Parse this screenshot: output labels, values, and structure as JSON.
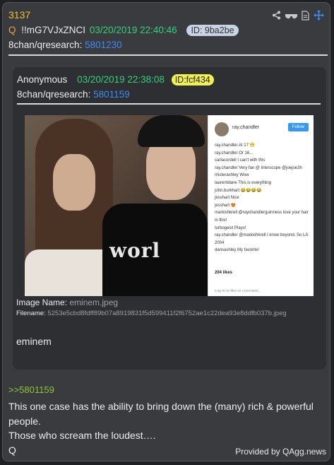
{
  "post": {
    "number": "3137",
    "q_marker": "Q",
    "tripcode": "!!mG7VJxZNCI",
    "datetime": "03/20/2019 22:40:46",
    "id_badge": "ID: 9ba2be",
    "board_label": "8chan/qresearch:",
    "board_link": "5801230",
    "reply_link": ">>5801159",
    "body_lines": [
      "This one case has the ability to bring down the (many) rich & powerful people.",
      "Those who scream the loudest….",
      "Q"
    ]
  },
  "actions": {
    "icons": [
      "share-icon",
      "glasses-icon",
      "document-icon",
      "move-icon"
    ],
    "accent": "#3d8cf5"
  },
  "quoted": {
    "author": "Anonymous",
    "datetime": "03/20/2019 22:38:08",
    "id_badge": "ID:fcf434",
    "board_label": "8chan/qresearch:",
    "board_link": "5801159",
    "image": {
      "shirt_text": "worl",
      "insta_username": "ray.chandler",
      "insta_follow": "Follow",
      "insta_comments": [
        "ray.chandler At 17 😁",
        "ray.chandler Or 16...",
        "carlacordell I can't with this",
        "ray.chandler Very fan @ interscope @joejoe3h",
        "misterashley Wow",
        "laurentdane This is everything",
        "john.burkhart 😂😂😂😂",
        "jesshart Nice",
        "jesshart 😍",
        "markishkrell @raychandlerguinness love your hair in this!",
        "turbogeist Plays!",
        "ray.chandler @markishkrell I know beyond. So LA 2004",
        "dansashley My favorite!"
      ],
      "insta_likes": "204 likes",
      "insta_login": "Log in to like or comment..."
    },
    "image_name_label": "Image Name:",
    "image_name_value": "eminem.jpeg",
    "filename_label": "Filename:",
    "filename_value": "5253e5cbd8fdff89b07a8919831f5d599411f2f6752ae1c22dea93e8ddfb037b.jpeg",
    "body": "eminem"
  },
  "footer": {
    "provided_by": "Provided by QAgg.news"
  },
  "colors": {
    "card_bg": "#3a3b3f",
    "post_number": "#f2c233",
    "date": "#33d17a",
    "link": "#3d8cf5",
    "reply_link": "#8fc43a",
    "id_badge_bg": "#c8d4e6",
    "quoted_id_badge_bg": "#f1f14a"
  }
}
